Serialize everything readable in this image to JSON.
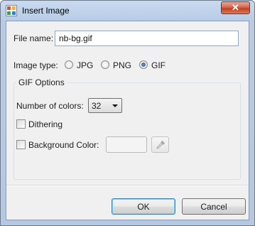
{
  "window": {
    "title": "Insert Image",
    "close_glyph": "✕"
  },
  "file_name": {
    "label": "File name:",
    "value": "nb-bg.gif"
  },
  "image_type": {
    "label": "Image type:",
    "options": [
      "JPG",
      "PNG",
      "GIF"
    ],
    "selected": "GIF"
  },
  "gif_options": {
    "title": "GIF Options",
    "colors_label": "Number of colors:",
    "colors_value": "32",
    "dithering_label": "Dithering",
    "dithering_checked": false,
    "background_label": "Background Color:",
    "background_checked": false
  },
  "buttons": {
    "ok": "OK",
    "cancel": "Cancel"
  },
  "icons": {
    "app": "image-app-icon",
    "picker": "eyedropper-icon"
  }
}
